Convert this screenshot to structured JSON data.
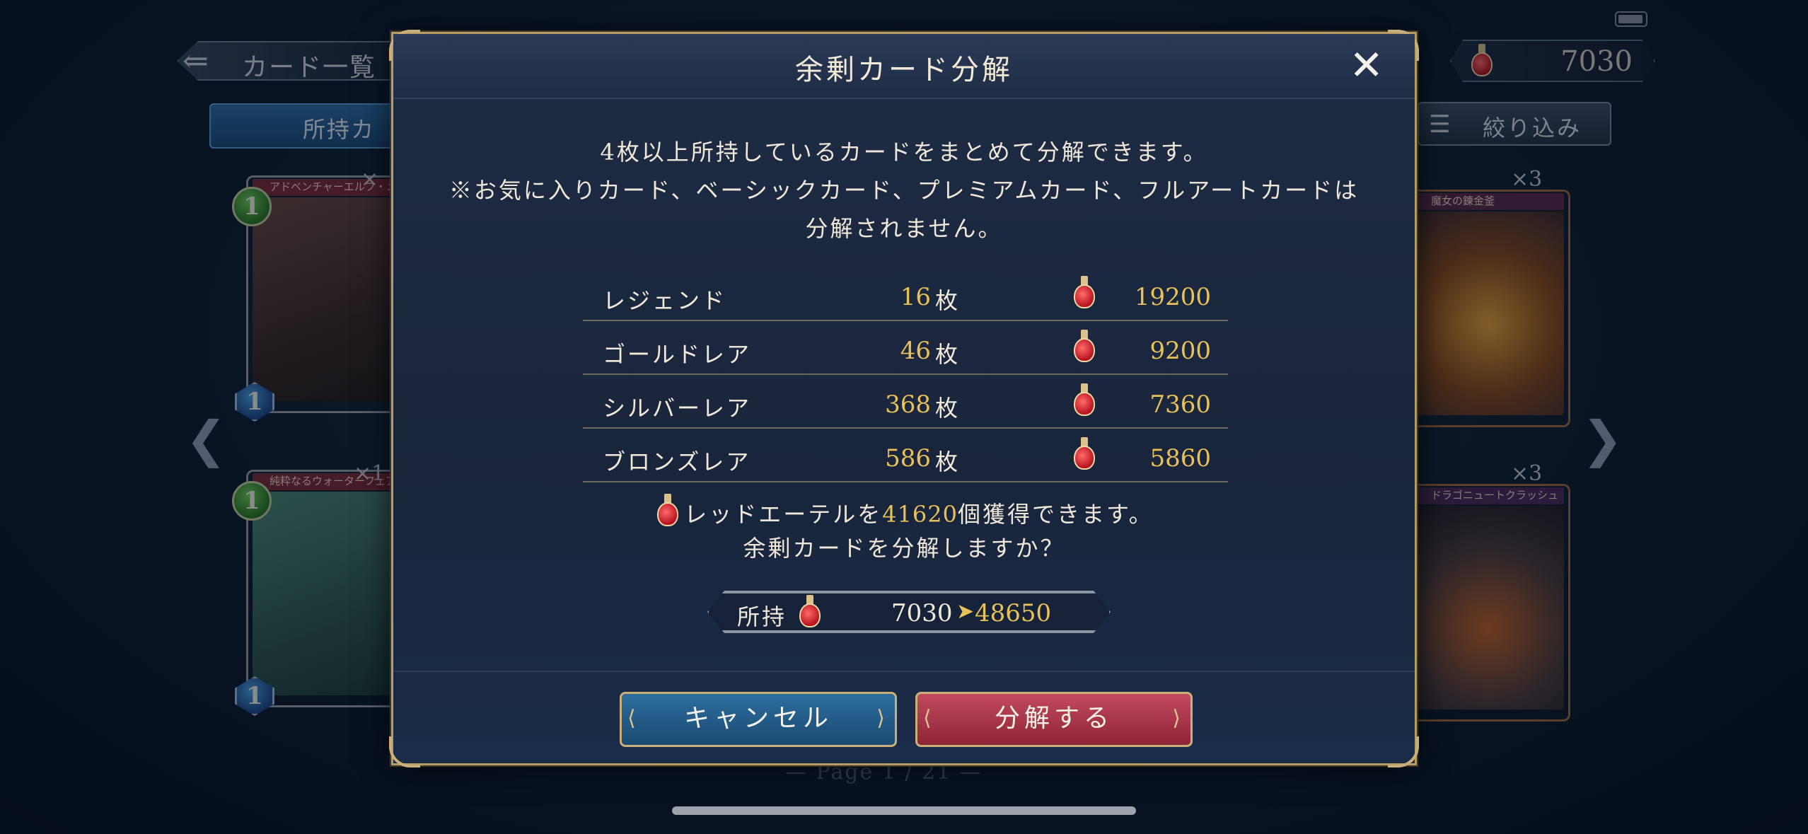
{
  "background": {
    "back_label": "カード一覧",
    "owned_tab_label": "所持カ",
    "currency_value": "7030",
    "filter_label": "絞り込み",
    "cards": [
      {
        "name": "アドベンチャーエルフ・メ",
        "cost": "1",
        "count": "×",
        "art": "#5b3f3a"
      },
      {
        "name": "純粋なるウォーターフェアリ",
        "cost": "1",
        "count": "×1",
        "art": "#3f6a62"
      },
      {
        "name": "魔女の錬金釜",
        "cost": "1",
        "count": "×3",
        "art": "#8a4a1e"
      },
      {
        "name": "ドラゴニュートクラッシュ",
        "cost": "1",
        "count": "×3",
        "art": "#4a3a3e"
      }
    ],
    "page_indicator": "— Page 1 / 21 —"
  },
  "dialog": {
    "title": "余剰カード分解",
    "description_lines": [
      "4枚以上所持しているカードをまとめて分解できます。",
      "※お気に入りカード、ベーシックカード、プレミアムカード、フルアートカードは",
      "分解されません。"
    ],
    "unit": "枚",
    "rows": [
      {
        "rarity": "レジェンド",
        "count": "16",
        "value": "19200"
      },
      {
        "rarity": "ゴールドレア",
        "count": "46",
        "value": "9200"
      },
      {
        "rarity": "シルバーレア",
        "count": "368",
        "value": "7360"
      },
      {
        "rarity": "ブロンズレア",
        "count": "586",
        "value": "5860"
      }
    ],
    "gain_prefix": "レッドエーテルを",
    "gain_amount": "41620",
    "gain_suffix": "個獲得できます。",
    "confirm_text": "余剰カードを分解しますか？",
    "owned_label": "所持",
    "owned_from": "7030",
    "owned_to": "48650",
    "cancel_label": "キャンセル",
    "confirm_label": "分解する"
  },
  "colors": {
    "accent_gold": "#e8c15a",
    "cancel_blue": "#2d6e9e",
    "confirm_red": "#c24a5e"
  }
}
